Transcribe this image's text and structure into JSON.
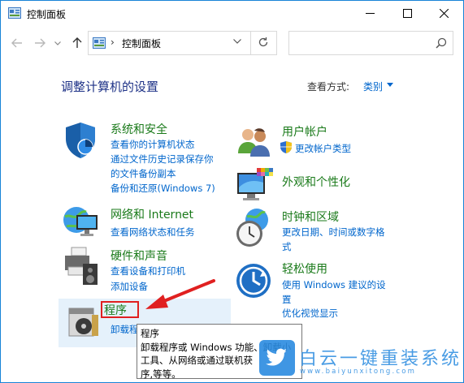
{
  "window": {
    "title": "控制面板"
  },
  "address_bar": {
    "separator": "›",
    "path": "控制面板"
  },
  "search": {
    "placeholder": ""
  },
  "main": {
    "heading": "调整计算机的设置",
    "view_by_label": "查看方式:",
    "view_by_value": "类别"
  },
  "categories": {
    "system": {
      "title": "系统和安全",
      "links": [
        "查看你的计算机状态",
        "通过文件历史记录保存你",
        "的文件备份副本",
        "备份和还原(Windows 7)"
      ]
    },
    "network": {
      "title": "网络和 Internet",
      "links": [
        "查看网络状态和任务"
      ]
    },
    "hardware": {
      "title": "硬件和声音",
      "links": [
        "查看设备和打印机",
        "添加设备"
      ]
    },
    "programs": {
      "title": "程序",
      "links": [
        "卸载程"
      ]
    },
    "accounts": {
      "title": "用户帐户",
      "links": [
        "更改帐户类型"
      ]
    },
    "appearance": {
      "title": "外观和个性化",
      "links": []
    },
    "clock": {
      "title": "时钟和区域",
      "links": [
        "更改日期、时间或数字格",
        "式"
      ]
    },
    "ease": {
      "title": "轻松使用",
      "links": [
        "使用 Windows 建议的设",
        "置",
        "优化视觉显示"
      ]
    }
  },
  "tooltip": {
    "title": "程序",
    "lines": [
      "卸载程序或 Windows 功能、卸载小",
      "工具、从网络或通过联机获",
      "序,等等。"
    ]
  },
  "watermark": {
    "text": "白云一键重装系统",
    "url": "www.baiyunxitong.com"
  },
  "colors": {
    "category_title": "#1a7a1a",
    "link": "#0066cc",
    "heading": "#1e3287",
    "highlight": "#e02020",
    "hover_bg": "#e5f1fb"
  }
}
